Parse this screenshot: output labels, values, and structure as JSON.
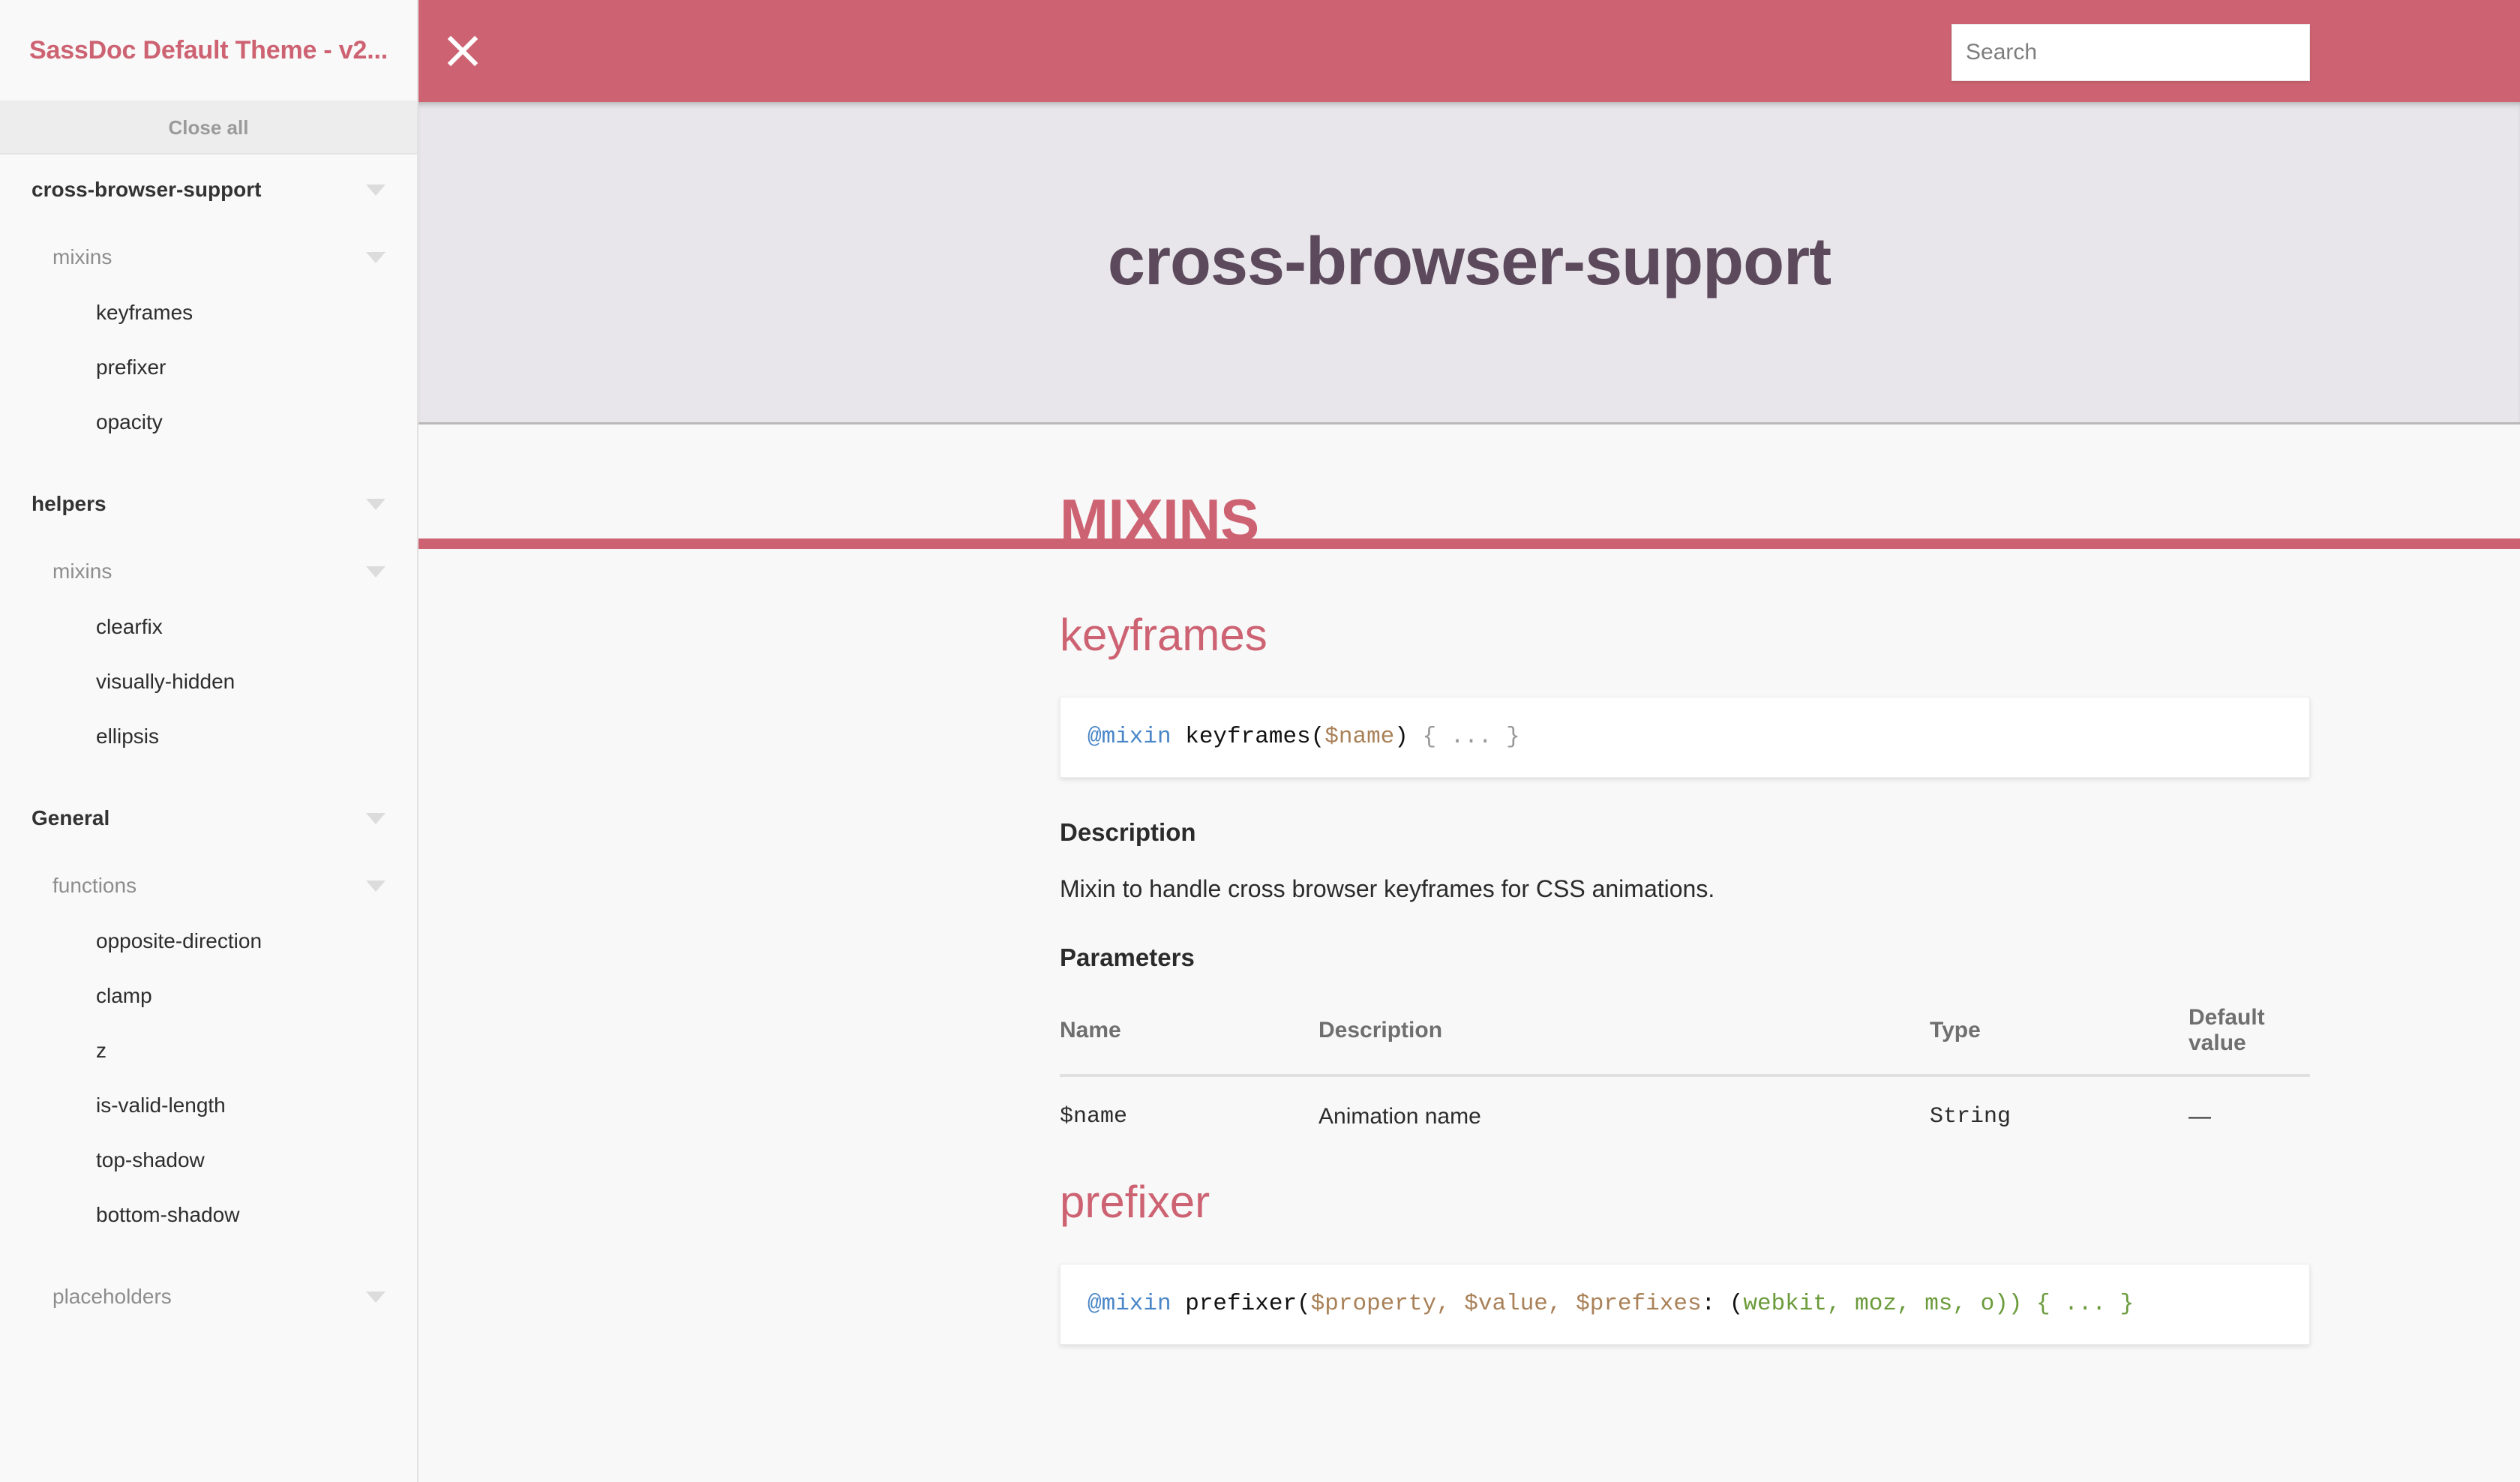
{
  "sidebar": {
    "title": "SassDoc Default Theme - v2...",
    "close_all_label": "Close all",
    "groups": [
      {
        "name": "cross-browser-support",
        "types": [
          {
            "name": "mixins",
            "items": [
              "keyframes",
              "prefixer",
              "opacity"
            ]
          }
        ]
      },
      {
        "name": "helpers",
        "types": [
          {
            "name": "mixins",
            "items": [
              "clearfix",
              "visually-hidden",
              "ellipsis"
            ]
          }
        ]
      },
      {
        "name": "General",
        "types": [
          {
            "name": "functions",
            "items": [
              "opposite-direction",
              "clamp",
              "z",
              "is-valid-length",
              "top-shadow",
              "bottom-shadow"
            ]
          },
          {
            "name": "placeholders",
            "items": []
          }
        ]
      }
    ]
  },
  "topbar": {
    "close_icon": "close-icon",
    "search_placeholder": "Search",
    "search_value": ""
  },
  "hero": {
    "title": "cross-browser-support"
  },
  "main": {
    "section_title": "MIXINS",
    "items": [
      {
        "name": "keyframes",
        "signature": {
          "at": "@mixin",
          "fn": " keyframes(",
          "var": "$name",
          "tail": ") ",
          "body": "{ ... }"
        },
        "description_heading": "Description",
        "description": "Mixin to handle cross browser keyframes for CSS animations.",
        "parameters_heading": "Parameters",
        "table": {
          "headers": [
            "Name",
            "Description",
            "Type",
            "Default value"
          ],
          "rows": [
            {
              "name": "$name",
              "description": "Animation name",
              "type": "String",
              "default": "—"
            }
          ]
        }
      },
      {
        "name": "prefixer",
        "signature": {
          "at": "@mixin",
          "fn": " prefixer(",
          "var": "$property, $value, $prefixes",
          "tail": ": (",
          "body": "webkit, moz, ms, o)) { ... }"
        }
      }
    ]
  },
  "colors": {
    "accent": "#cd6372",
    "hero_bg": "#e8e6ea",
    "hero_text": "#5c4a5c",
    "sidebar_bg": "#f9f9f9",
    "page_bg": "#f8f8f8"
  }
}
